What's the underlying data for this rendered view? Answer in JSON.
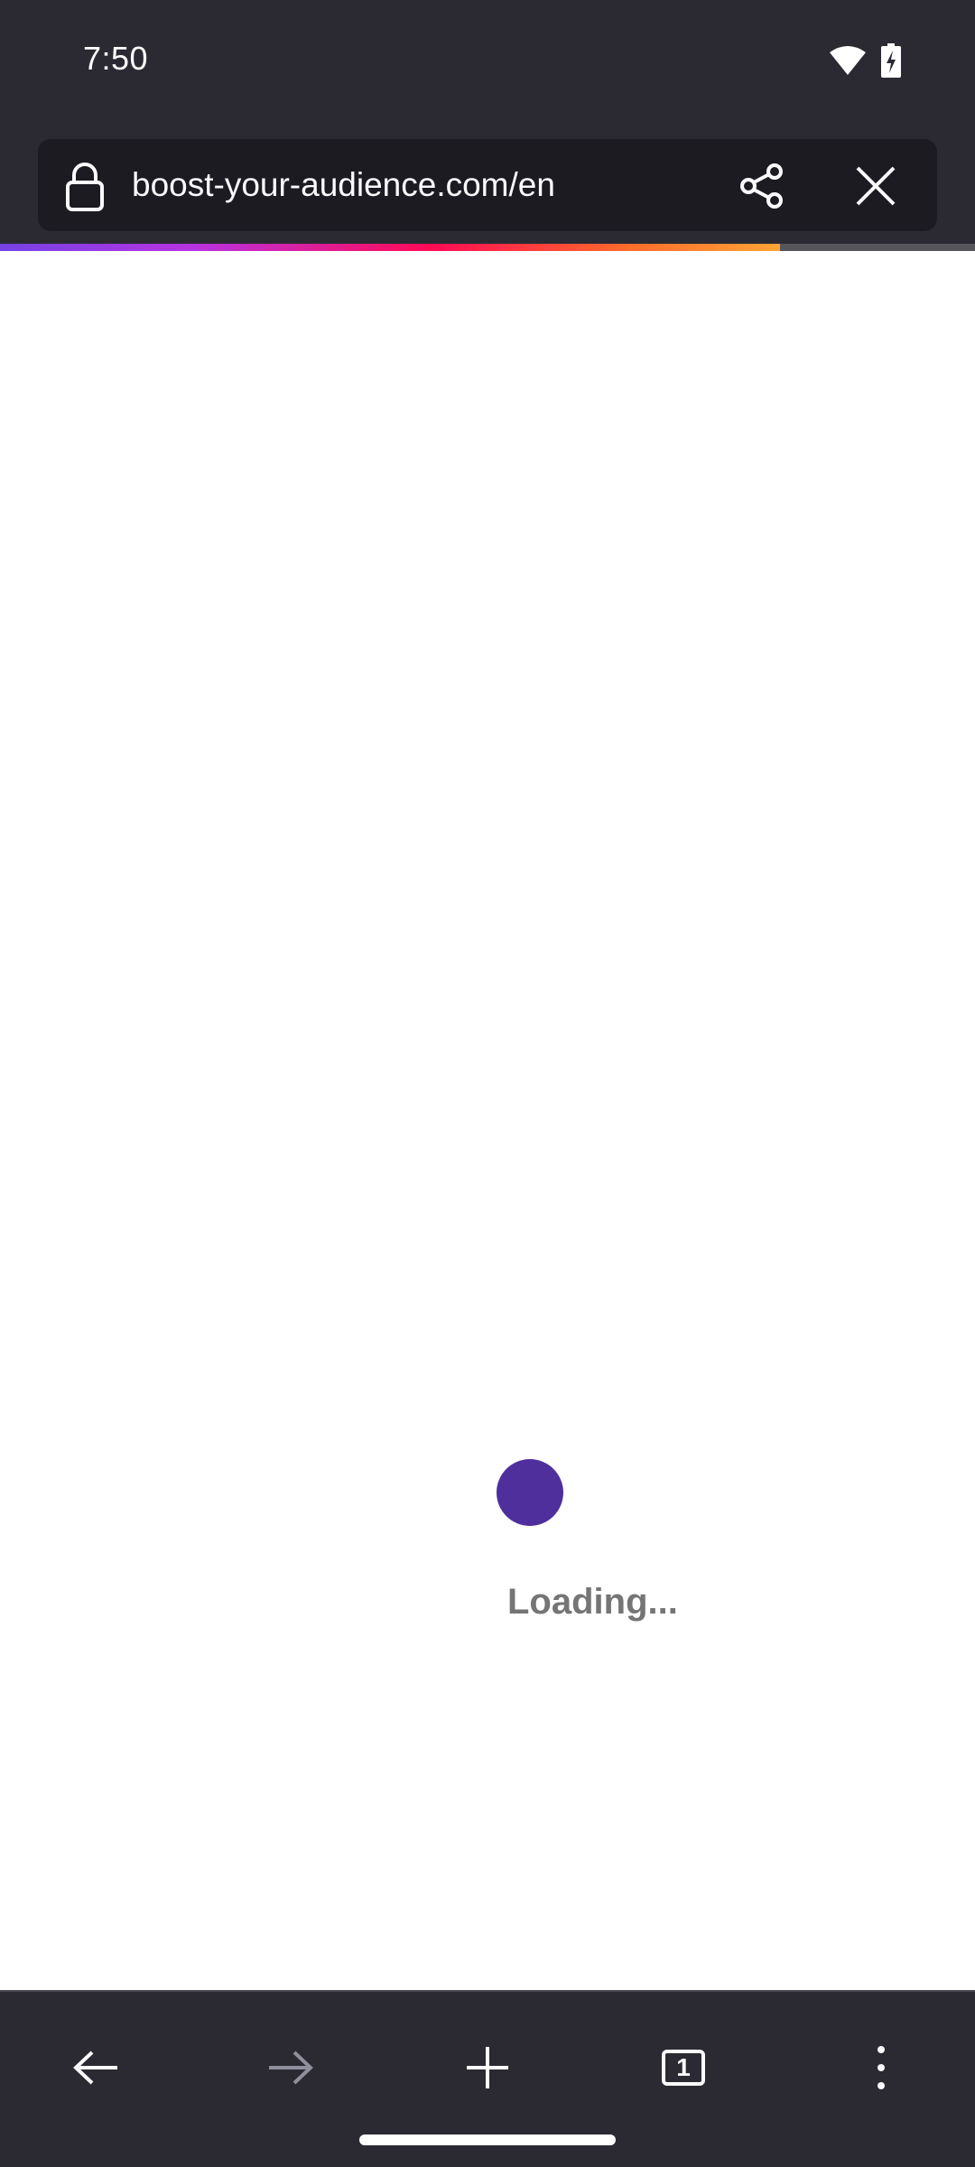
{
  "status_bar": {
    "time": "7:50",
    "icons": [
      "wifi-icon",
      "battery-charging-icon"
    ]
  },
  "toolbar": {
    "url": "boost-your-audience.com/en",
    "icons": [
      "lock-icon",
      "share-icon",
      "close-icon"
    ]
  },
  "progress": {
    "fraction": 0.8
  },
  "page": {
    "loading_text": "Loading..."
  },
  "bottom_bar": {
    "tab_count": "1",
    "icons": [
      "back-arrow-icon",
      "forward-arrow-icon",
      "plus-icon",
      "tabs-icon",
      "more-vertical-icon"
    ]
  },
  "colors": {
    "chrome_bg": "#2b2a33",
    "url_field_bg": "#1c1b22",
    "loader_dot": "#4e2f9c",
    "loading_text": "#757575"
  }
}
